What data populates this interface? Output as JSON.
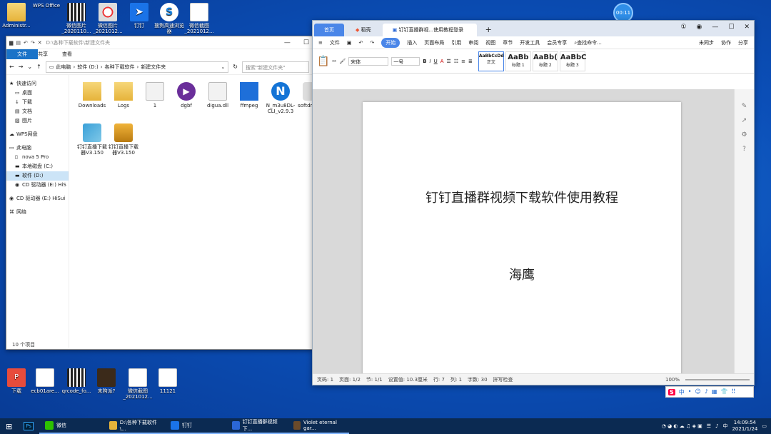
{
  "desktop": {
    "icons": [
      {
        "label": "Administr...",
        "type": "folder"
      },
      {
        "label": "WPS Office",
        "type": "wps",
        "glyph": "W"
      },
      {
        "label": "微信图片_2020110...",
        "type": "qr"
      },
      {
        "label": "微信图片_2021012...",
        "type": "red"
      },
      {
        "label": "钉钉",
        "type": "ding",
        "glyph": "➤"
      },
      {
        "label": "搜狗高速浏览器",
        "type": "sogou",
        "glyph": "S"
      },
      {
        "label": "微信截图_2021012...",
        "type": "doc"
      }
    ],
    "bottom_icons": [
      {
        "label": "下载",
        "type": "pdf",
        "glyph": "P"
      },
      {
        "label": "ecb01are...",
        "type": "doc"
      },
      {
        "label": "qrcode_fo...",
        "type": "qr"
      },
      {
        "label": "末狗派?",
        "type": "game"
      },
      {
        "label": "微信截图_2021012...",
        "type": "doc"
      },
      {
        "label": "11121",
        "type": "doc"
      }
    ]
  },
  "explorer": {
    "path_title": "D:\\各种下载软件\\新建文件夹",
    "tabs": [
      "文件",
      "主页",
      "共享",
      "查看"
    ],
    "breadcrumb": [
      "此电脑",
      "软件 (D:)",
      "各种下载软件",
      "新建文件夹"
    ],
    "search_placeholder": "搜索\"新建文件夹\"",
    "nav": [
      {
        "label": "快速访问",
        "icon": "★"
      },
      {
        "label": "桌面",
        "icon": "▭"
      },
      {
        "label": "下载",
        "icon": "↓"
      },
      {
        "label": "文档",
        "icon": "▤"
      },
      {
        "label": "图片",
        "icon": "▨"
      },
      {
        "label": "WPS网盘",
        "icon": "☁"
      },
      {
        "label": "此电脑",
        "icon": "▭"
      },
      {
        "label": "nova 5 Pro",
        "icon": "▯"
      },
      {
        "label": "本地磁盘 (C:)",
        "icon": "▬"
      },
      {
        "label": "软件 (D:)",
        "icon": "▬"
      },
      {
        "label": "CD 驱动器 (E:) HiS",
        "icon": "◉"
      },
      {
        "label": "CD 驱动器 (E:) HiSui",
        "icon": "◉"
      },
      {
        "label": "网络",
        "icon": "⌘"
      }
    ],
    "files": [
      {
        "label": "Downloads",
        "type": "folder"
      },
      {
        "label": "Logs",
        "type": "folder"
      },
      {
        "label": "1",
        "type": "dll"
      },
      {
        "label": "dgbf",
        "type": "dg",
        "glyph": "▶"
      },
      {
        "label": "digua.dll",
        "type": "dll"
      },
      {
        "label": "ffmpeg",
        "type": "ff"
      },
      {
        "label": "N_m3u8DL-CLI_v2.9.3",
        "type": "n",
        "glyph": "N"
      },
      {
        "label": "softdm nfig",
        "type": "gear"
      },
      {
        "label": "钉钉直播下载器V3.150",
        "type": "ding2"
      },
      {
        "label": "钉钉直播下载器V3.150",
        "type": "ding3"
      }
    ],
    "status": "10 个项目"
  },
  "wps": {
    "tabs": {
      "home": "首页",
      "shell": "稻壳",
      "doc": "钉钉直播群视...使用教程登录"
    },
    "menu": [
      "文件",
      "开始",
      "插入",
      "页面布局",
      "引用",
      "审阅",
      "视图",
      "章节",
      "开发工具",
      "会员专享"
    ],
    "menu_search": "查找命令...",
    "menu_right": [
      "未同步",
      "协作",
      "分享"
    ],
    "font_name": "宋体",
    "font_size": "一号",
    "styles": [
      {
        "sample": "AaBbCcDd",
        "name": "正文"
      },
      {
        "sample": "AaBb",
        "name": "标题 1"
      },
      {
        "sample": "AaBb(",
        "name": "标题 2"
      },
      {
        "sample": "AaBbC",
        "name": "标题 3"
      }
    ],
    "doc_title": "钉钉直播群视频下载软件使用教程",
    "doc_author": "海鹰",
    "status": [
      "页码: 1",
      "页面: 1/2",
      "节: 1/1",
      "设置值: 10.3厘米",
      "行: 7",
      "列: 1",
      "字数: 30",
      "拼写检查"
    ],
    "zoom": "100%"
  },
  "timer": "00:11",
  "ime": {
    "logo": "S",
    "items": [
      "中",
      "•",
      "☺",
      "♪",
      "▦",
      "👕",
      "⠿"
    ]
  },
  "taskbar": {
    "items": [
      {
        "label": "微信",
        "color": "#2dc100"
      },
      {
        "label": "D:\\各种下载软件\\...",
        "color": "#e6b33a"
      },
      {
        "label": "钉钉",
        "color": "#1a73e8"
      },
      {
        "label": "钉钉直播群视频下...",
        "color": "#2b67d6"
      },
      {
        "label": "Violet eternal gar...",
        "color": "#6b4a2a"
      }
    ],
    "ps_label": "Ps",
    "tray_lang": "中",
    "time": "14:09:54",
    "date": "2021/1/24"
  }
}
